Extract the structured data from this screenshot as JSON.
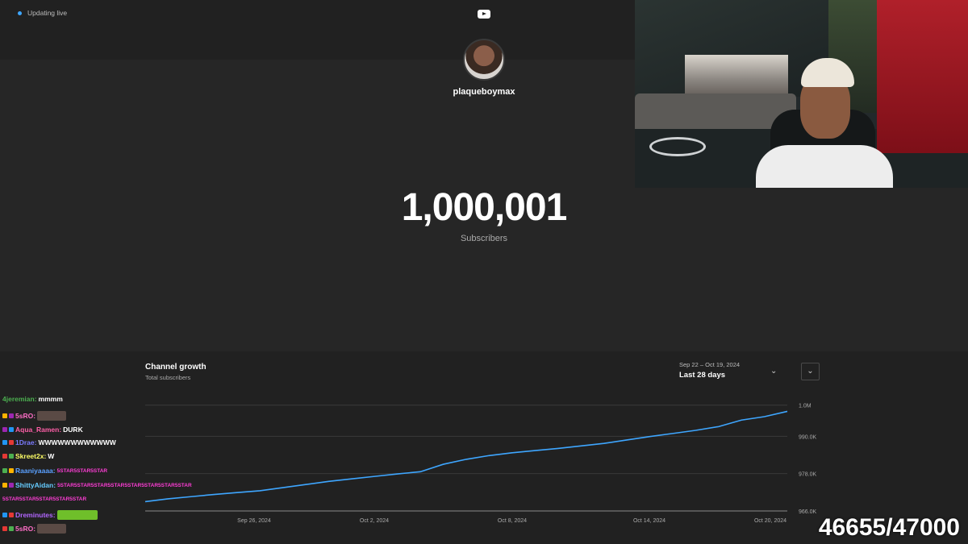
{
  "header": {
    "live_status": "Updating live",
    "icon": "youtube-icon"
  },
  "channel": {
    "name": "plaqueboymax",
    "subscriber_count": "1,000,001",
    "subscriber_label": "Subscribers"
  },
  "growth": {
    "title": "Channel growth",
    "subtitle": "Total subscribers",
    "date_range": "Sep 22 – Oct 19, 2024",
    "period": "Last 28 days"
  },
  "chart_data": {
    "type": "line",
    "xlabel": "",
    "ylabel": "",
    "x_ticks": [
      "Sep 26, 2024",
      "Oct 2, 2024",
      "Oct 8, 2024",
      "Oct 14, 2024",
      "Oct 20, 2024"
    ],
    "y_ticks": [
      "966.0K",
      "978.0K",
      "990.0K",
      "1.0M"
    ],
    "ylim": [
      966000,
      1002000
    ],
    "grid": true,
    "series": [
      {
        "name": "",
        "x": [
          0,
          1,
          2,
          3,
          4,
          5,
          6,
          7,
          8,
          9,
          10,
          11,
          12,
          13,
          14,
          15,
          16,
          17,
          18,
          19,
          20,
          21,
          22,
          23,
          24,
          25,
          26,
          27,
          28
        ],
        "values": [
          969000,
          969900,
          970600,
          971300,
          971900,
          972500,
          973500,
          974500,
          975500,
          976300,
          977100,
          977900,
          978600,
          981000,
          982600,
          983800,
          984700,
          985400,
          986100,
          986900,
          987700,
          988800,
          989900,
          990900,
          991900,
          993100,
          995200,
          996300,
          998000
        ],
        "color": "#3ea6ff"
      }
    ]
  },
  "chat": [
    {
      "user": "4jeremian",
      "user_color": "#4caf50",
      "message": "mmmm"
    },
    {
      "user": "5sRO",
      "user_color": "#ff6ec7",
      "message": ""
    },
    {
      "user": "Aqua_Ramen",
      "user_color": "#ff5fa8",
      "message": "DURK"
    },
    {
      "user": "1Drae",
      "user_color": "#7b7bff",
      "message": "WWWWWWWWWWWW"
    },
    {
      "user": "Skreet2x",
      "user_color": "#ffff66",
      "message": "W"
    },
    {
      "user": "Raaniyaaaa",
      "user_color": "#5aa0ff",
      "message": "5STAR5STAR5STAR"
    },
    {
      "user": "ShittyAidan",
      "user_color": "#66ccff",
      "message": "5STAR5STAR5STAR5STAR5STAR5STAR5STAR5STAR"
    },
    {
      "user": "",
      "user_color": "#ff66ff",
      "message": "5STAR5STAR5STAR5STAR5STAR"
    },
    {
      "user": "Dreminutes",
      "user_color": "#b266ff",
      "message": ""
    },
    {
      "user": "5sRO",
      "user_color": "#ff6ec7",
      "message": ""
    }
  ],
  "goal": {
    "text": "46655/47000"
  }
}
